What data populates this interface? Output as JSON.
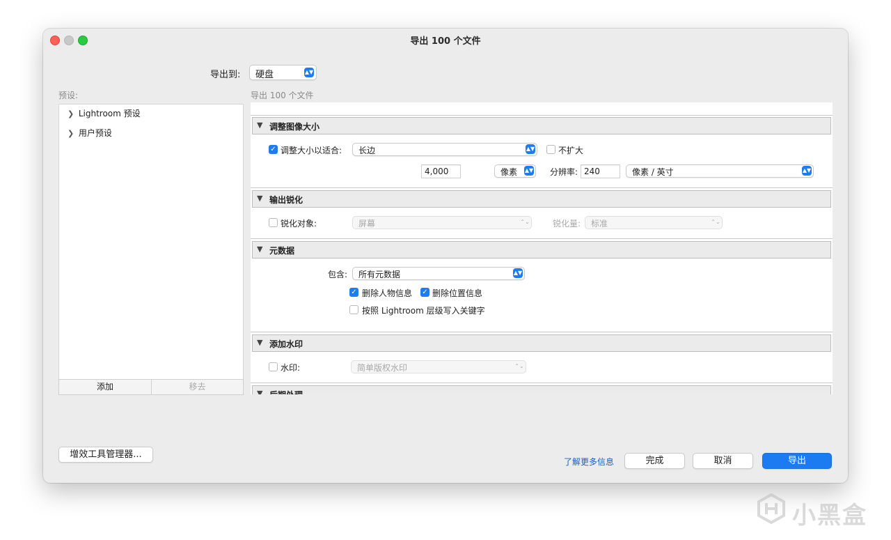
{
  "window": {
    "title": "导出 100 个文件"
  },
  "export_to": {
    "label": "导出到:",
    "value": "硬盘"
  },
  "presets": {
    "label": "预设:",
    "items": [
      {
        "label": "Lightroom 预设"
      },
      {
        "label": "用户预设"
      }
    ],
    "add_label": "添加",
    "remove_label": "移去"
  },
  "main": {
    "subtitle": "导出 100 个文件",
    "resize": {
      "title": "调整图像大小",
      "fit_checkbox_label": "调整大小以适合:",
      "fit_checked": true,
      "fit_value": "长边",
      "no_enlarge_label": "不扩大",
      "no_enlarge_checked": false,
      "size_value": "4,000",
      "size_unit": "像素",
      "resolution_label": "分辨率:",
      "resolution_value": "240",
      "resolution_unit": "像素 / 英寸"
    },
    "sharpen": {
      "title": "输出锐化",
      "checkbox_label": "锐化对象:",
      "checked": false,
      "target_value": "屏幕",
      "amount_label": "锐化量:",
      "amount_value": "标准"
    },
    "metadata": {
      "title": "元数据",
      "include_label": "包含:",
      "include_value": "所有元数据",
      "remove_person_label": "删除人物信息",
      "remove_person_checked": true,
      "remove_location_label": "删除位置信息",
      "remove_location_checked": true,
      "keywords_label": "按照 Lightroom 层级写入关键字",
      "keywords_checked": false
    },
    "watermark": {
      "title": "添加水印",
      "checkbox_label": "水印:",
      "checked": false,
      "value": "简单版权水印"
    },
    "post": {
      "title": "后期处理"
    }
  },
  "footer": {
    "plugin_manager_label": "增效工具管理器...",
    "learn_more_label": "了解更多信息",
    "done_label": "完成",
    "cancel_label": "取消",
    "export_label": "导出"
  },
  "brand_watermark": {
    "text": "小黑盒"
  },
  "colors": {
    "accent": "#1e7cf2",
    "window_bg": "#ececec"
  }
}
